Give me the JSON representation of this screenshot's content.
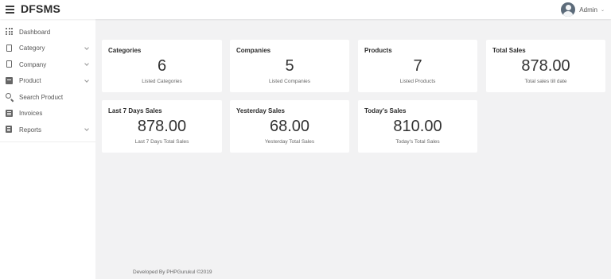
{
  "app": {
    "brand": "DFSMS"
  },
  "user": {
    "name": "Admin"
  },
  "sidebar": {
    "items": [
      {
        "label": "Dashboard",
        "icon": "grid-icon",
        "has_caret": false
      },
      {
        "label": "Category",
        "icon": "document-icon",
        "has_caret": true
      },
      {
        "label": "Company",
        "icon": "document-icon",
        "has_caret": true
      },
      {
        "label": "Product",
        "icon": "box-icon",
        "has_caret": true
      },
      {
        "label": "Search Product",
        "icon": "search-icon",
        "has_caret": false
      },
      {
        "label": "Invoices",
        "icon": "invoice-icon",
        "has_caret": false
      },
      {
        "label": "Reports",
        "icon": "report-icon",
        "has_caret": true
      }
    ]
  },
  "cards": [
    {
      "title": "Categories",
      "value": "6",
      "subtitle": "Listed Categories"
    },
    {
      "title": "Companies",
      "value": "5",
      "subtitle": "Listed Companies"
    },
    {
      "title": "Products",
      "value": "7",
      "subtitle": "Listed Products"
    },
    {
      "title": "Total Sales",
      "value": "878.00",
      "subtitle": "Total sales till date"
    },
    {
      "title": "Last 7 Days Sales",
      "value": "878.00",
      "subtitle": "Last 7 Days Total Sales"
    },
    {
      "title": "Yesterday Sales",
      "value": "68.00",
      "subtitle": "Yesterday Total Sales"
    },
    {
      "title": "Today's Sales",
      "value": "810.00",
      "subtitle": "Today's Total Sales"
    }
  ],
  "footer": {
    "text": "Developed By PHPGurukul ©2019"
  },
  "colors": {
    "background": "#f2f2f3",
    "card": "#ffffff",
    "sidebar": "#ffffff",
    "avatar": "#5c6b7a"
  }
}
